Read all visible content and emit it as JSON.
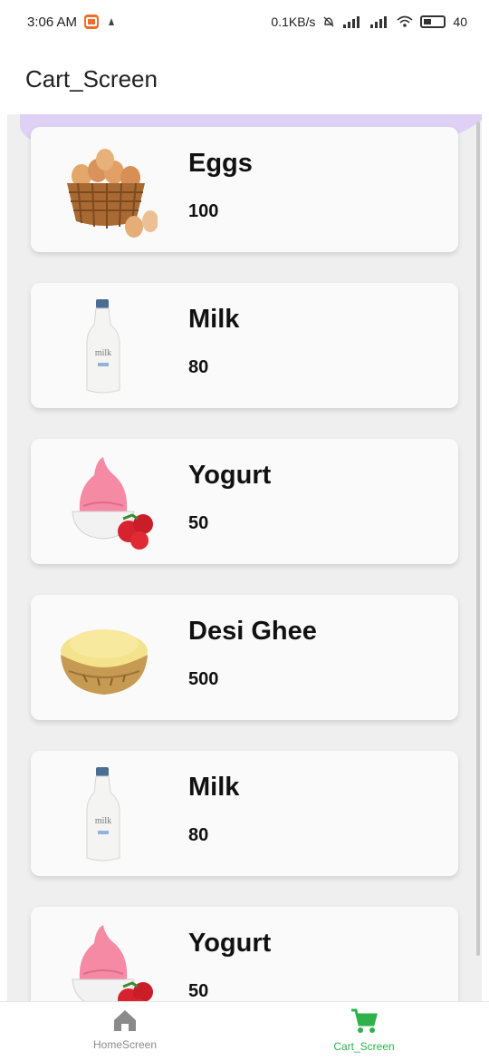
{
  "status_bar": {
    "time": "3:06 AM",
    "speed": "0.1KB/s",
    "battery": "40"
  },
  "app_bar": {
    "title": "Cart_Screen"
  },
  "cart": {
    "items": [
      {
        "name": "Eggs",
        "price": "100",
        "image_icon": "eggs-basket-image"
      },
      {
        "name": "Milk",
        "price": "80",
        "image_icon": "milk-bottle-image"
      },
      {
        "name": "Yogurt",
        "price": "50",
        "image_icon": "yogurt-strawberry-image"
      },
      {
        "name": "Desi Ghee",
        "price": "500",
        "image_icon": "ghee-bowl-image"
      },
      {
        "name": "Milk",
        "price": "80",
        "image_icon": "milk-bottle-image"
      },
      {
        "name": "Yogurt",
        "price": "50",
        "image_icon": "yogurt-strawberry-image"
      }
    ]
  },
  "bottom_nav": {
    "items": [
      {
        "label": "HomeScreen",
        "icon": "home-icon",
        "active": false
      },
      {
        "label": "Cart_Screen",
        "icon": "cart-icon",
        "active": true
      }
    ],
    "active_color": "#2db34a",
    "inactive_color": "#8a8a8a"
  }
}
